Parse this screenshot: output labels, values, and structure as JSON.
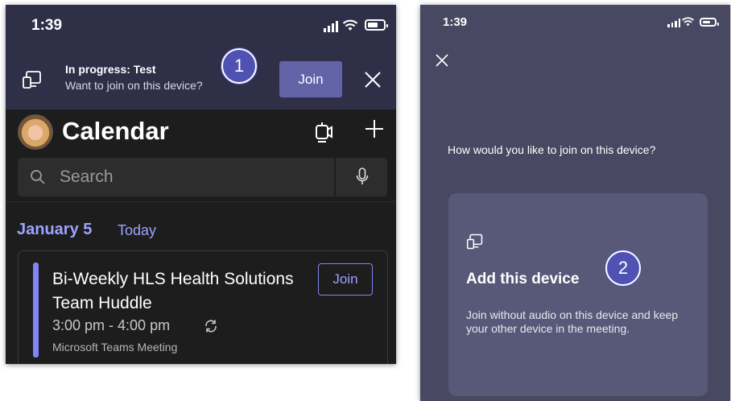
{
  "left_screen": {
    "status": {
      "time": "1:39"
    },
    "banner": {
      "title": "In progress: Test",
      "subtitle": "Want to join on this device?",
      "join_label": "Join",
      "device_icon": "device-cast-icon",
      "close_icon": "close-icon"
    },
    "header": {
      "title": "Calendar",
      "meet_now_icon": "video-meet-icon",
      "add_icon": "plus-icon"
    },
    "search": {
      "placeholder": "Search",
      "mic_icon": "microphone-icon"
    },
    "date": {
      "label": "January 5",
      "today": "Today"
    },
    "event": {
      "title": "Bi-Weekly HLS Health Solutions Team Huddle",
      "time": "3:00 pm - 4:00 pm",
      "subtitle": "Microsoft Teams Meeting",
      "join_label": "Join",
      "repeat_icon": "recurring-icon"
    },
    "callout": "1"
  },
  "right_screen": {
    "status": {
      "time": "1:39"
    },
    "question": "How would you like to join on this device?",
    "option": {
      "title": "Add this device",
      "description": "Join without audio on this device and keep your other device in the meeting.",
      "icon": "device-cast-icon"
    },
    "callout": "2"
  },
  "colors": {
    "banner_bg": "#2f3047",
    "accent": "#6264a7",
    "link": "#9ea2ff",
    "right_bg": "#484862",
    "card_bg": "#585978",
    "callout": "#4f52b2"
  }
}
